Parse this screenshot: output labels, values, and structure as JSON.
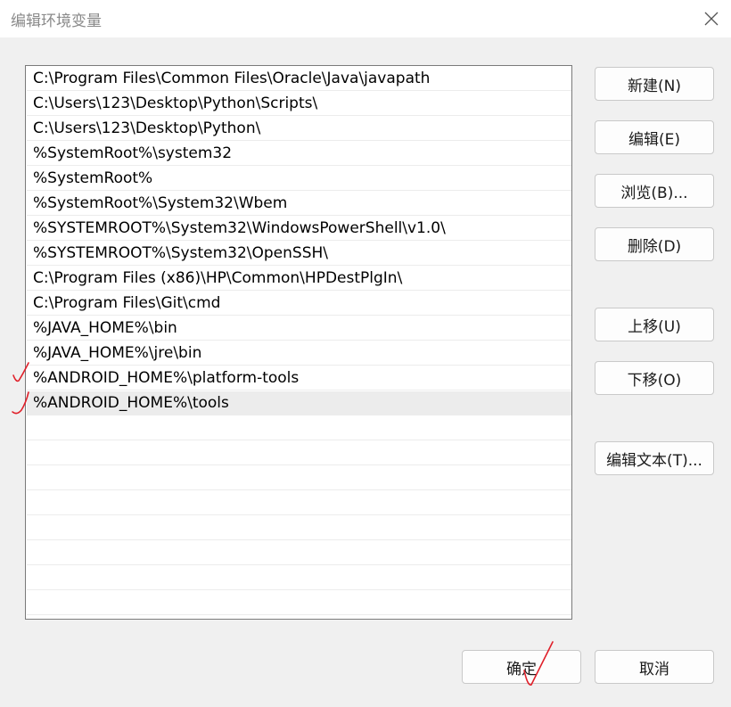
{
  "window": {
    "title": "编辑环境变量",
    "close_icon": "close-icon"
  },
  "path_list": {
    "selected_index": 12,
    "entries": [
      "C:\\Program Files\\Common Files\\Oracle\\Java\\javapath",
      "C:\\Users\\123\\Desktop\\Python\\Scripts\\",
      "C:\\Users\\123\\Desktop\\Python\\",
      "%SystemRoot%\\system32",
      "%SystemRoot%",
      "%SystemRoot%\\System32\\Wbem",
      "%SYSTEMROOT%\\System32\\WindowsPowerShell\\v1.0\\",
      "%SYSTEMROOT%\\System32\\OpenSSH\\",
      "C:\\Program Files (x86)\\HP\\Common\\HPDestPlgIn\\",
      "C:\\Program Files\\Git\\cmd",
      "%JAVA_HOME%\\bin",
      "%JAVA_HOME%\\jre\\bin",
      "%ANDROID_HOME%\\platform-tools",
      "%ANDROID_HOME%\\tools"
    ]
  },
  "buttons": {
    "new": "新建(N)",
    "edit": "编辑(E)",
    "browse": "浏览(B)...",
    "delete": "删除(D)",
    "move_up": "上移(U)",
    "move_down": "下移(O)",
    "edit_text": "编辑文本(T)...",
    "ok": "确定",
    "cancel": "取消"
  },
  "annotations": {
    "color": "#e0202a"
  }
}
